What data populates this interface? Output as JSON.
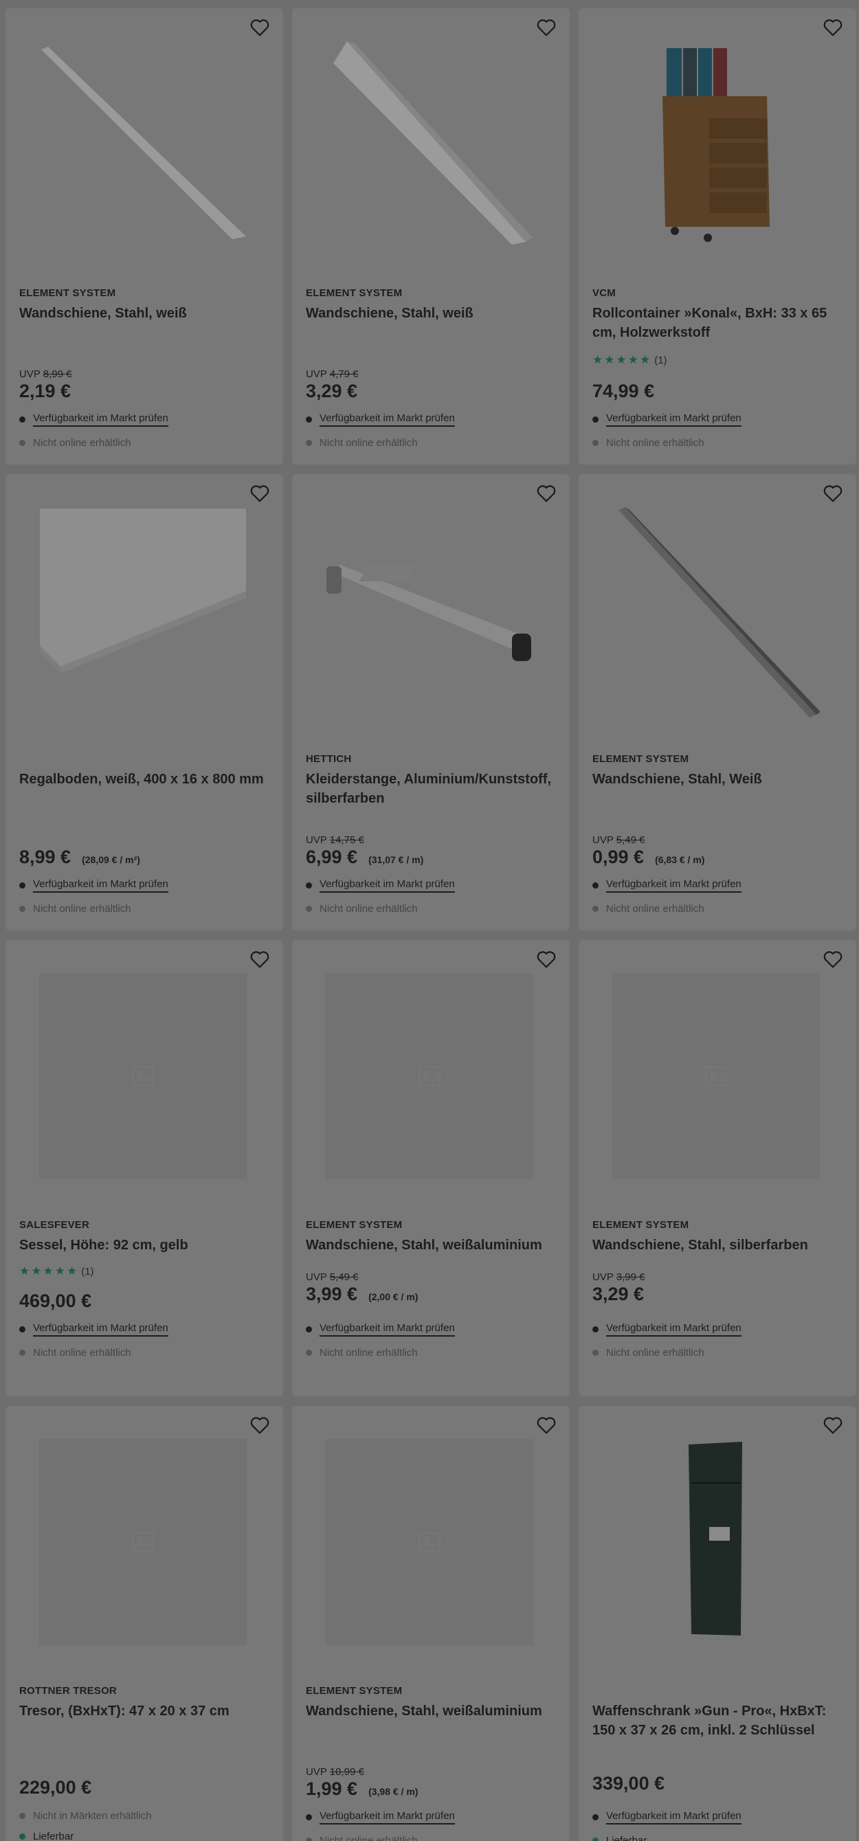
{
  "products": [
    {
      "brand": "ELEMENT SYSTEM",
      "title": "Wandschiene, Stahl, weiß",
      "rating": null,
      "uvp_label": "UVP",
      "uvp_value": "8,99 €",
      "price": "2,19 €",
      "unit_price": "",
      "availability": [
        "Verfügbarkeit im Markt prüfen",
        "Nicht online erhältlich"
      ]
    },
    {
      "brand": "ELEMENT SYSTEM",
      "title": "Wandschiene, Stahl, weiß",
      "rating": null,
      "uvp_label": "UVP",
      "uvp_value": "4,79 €",
      "price": "3,29 €",
      "unit_price": "",
      "availability": [
        "Verfügbarkeit im Markt prüfen",
        "Nicht online erhältlich"
      ]
    },
    {
      "brand": "VCM",
      "title": "Rollcontainer »Konal«, BxH: 33 x 65 cm, Holzwerkstoff",
      "rating": {
        "stars": "★★★★★",
        "count": "(1)"
      },
      "uvp_label": "",
      "uvp_value": "",
      "price": "74,99 €",
      "unit_price": "",
      "availability": [
        "Verfügbarkeit im Markt prüfen",
        "Nicht online erhältlich"
      ]
    },
    {
      "brand": "",
      "title": "Regalboden, weiß, 400 x 16 x 800 mm",
      "rating": null,
      "uvp_label": "",
      "uvp_value": "",
      "price": "8,99 €",
      "unit_price": "(28,09 € / m²)",
      "availability": [
        "Verfügbarkeit im Markt prüfen",
        "Nicht online erhältlich"
      ]
    },
    {
      "brand": "HETTICH",
      "title": "Kleiderstange, Aluminium/Kunststoff, silberfarben",
      "rating": null,
      "uvp_label": "UVP",
      "uvp_value": "14,75 €",
      "price": "6,99 €",
      "unit_price": "(31,07 € / m)",
      "availability": [
        "Verfügbarkeit im Markt prüfen",
        "Nicht online erhältlich"
      ]
    },
    {
      "brand": "ELEMENT SYSTEM",
      "title": "Wandschiene, Stahl, Weiß",
      "rating": null,
      "uvp_label": "UVP",
      "uvp_value": "5,49 €",
      "price": "0,99 €",
      "unit_price": "(6,83 € / m)",
      "availability": [
        "Verfügbarkeit im Markt prüfen",
        "Nicht online erhältlich"
      ]
    },
    {
      "brand": "SALESFEVER",
      "title": "Sessel, Höhe: 92 cm, gelb",
      "rating": {
        "stars": "★★★★★",
        "count": "(1)"
      },
      "uvp_label": "",
      "uvp_value": "",
      "price": "469,00 €",
      "unit_price": "",
      "availability": [
        "Verfügbarkeit im Markt prüfen",
        "Nicht online erhältlich"
      ]
    },
    {
      "brand": "ELEMENT SYSTEM",
      "title": "Wandschiene, Stahl, weißaluminium",
      "rating": null,
      "uvp_label": "UVP",
      "uvp_value": "5,49 €",
      "price": "3,99 €",
      "unit_price": "(2,00 € / m)",
      "availability": [
        "Verfügbarkeit im Markt prüfen",
        "Nicht online erhältlich"
      ]
    },
    {
      "brand": "ELEMENT SYSTEM",
      "title": "Wandschiene, Stahl, silberfarben",
      "rating": null,
      "uvp_label": "UVP",
      "uvp_value": "3,99 €",
      "price": "3,29 €",
      "unit_price": "",
      "availability": [
        "Verfügbarkeit im Markt prüfen",
        "Nicht online erhältlich"
      ]
    },
    {
      "brand": "ROTTNER TRESOR",
      "title": "Tresor, (BxHxT): 47 x 20 x 37 cm",
      "rating": null,
      "uvp_label": "",
      "uvp_value": "",
      "price": "229,00 €",
      "unit_price": "",
      "availability": [
        "Nicht in Märkten erhältlich",
        "Lieferbar"
      ]
    },
    {
      "brand": "ELEMENT SYSTEM",
      "title": "Wandschiene, Stahl, weißaluminium",
      "rating": null,
      "uvp_label": "UVP",
      "uvp_value": "10,99 €",
      "price": "1,99 €",
      "unit_price": "(3,98 € / m)",
      "availability": [
        "Verfügbarkeit im Markt prüfen",
        "Nicht online erhältlich"
      ]
    },
    {
      "brand": "",
      "title": "Waffenschrank »Gun - Pro«, HxBxT: 150 x 37 x 26 cm, inkl. 2 Schlüssel",
      "rating": null,
      "uvp_label": "",
      "uvp_value": "",
      "price": "339,00 €",
      "unit_price": "",
      "availability": [
        "Verfügbarkeit im Markt prüfen",
        "Lieferbar"
      ]
    }
  ],
  "colors": {
    "accent_green": "#1f5a4d",
    "overlay": "#6e6e6e"
  }
}
